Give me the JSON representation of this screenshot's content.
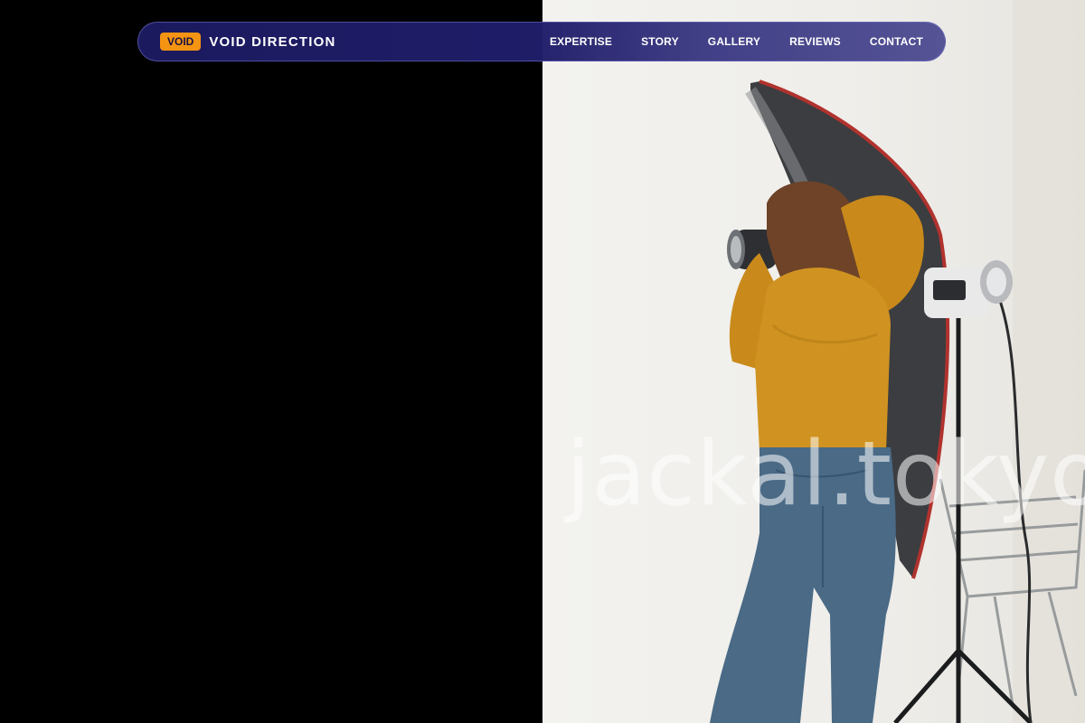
{
  "nav": {
    "brand": {
      "badge": "VOID",
      "name": "VOID DIRECTION"
    },
    "links": [
      {
        "label": "EXPERTISE"
      },
      {
        "label": "STORY"
      },
      {
        "label": "GALLERY"
      },
      {
        "label": "REVIEWS"
      },
      {
        "label": "CONTACT"
      }
    ]
  },
  "hero": {
    "image_watermark": "jackal.tokyo"
  },
  "colors": {
    "nav_bg": "#1c1a5e",
    "badge_bg": "#f59412",
    "left_panel_bg": "#000000"
  }
}
